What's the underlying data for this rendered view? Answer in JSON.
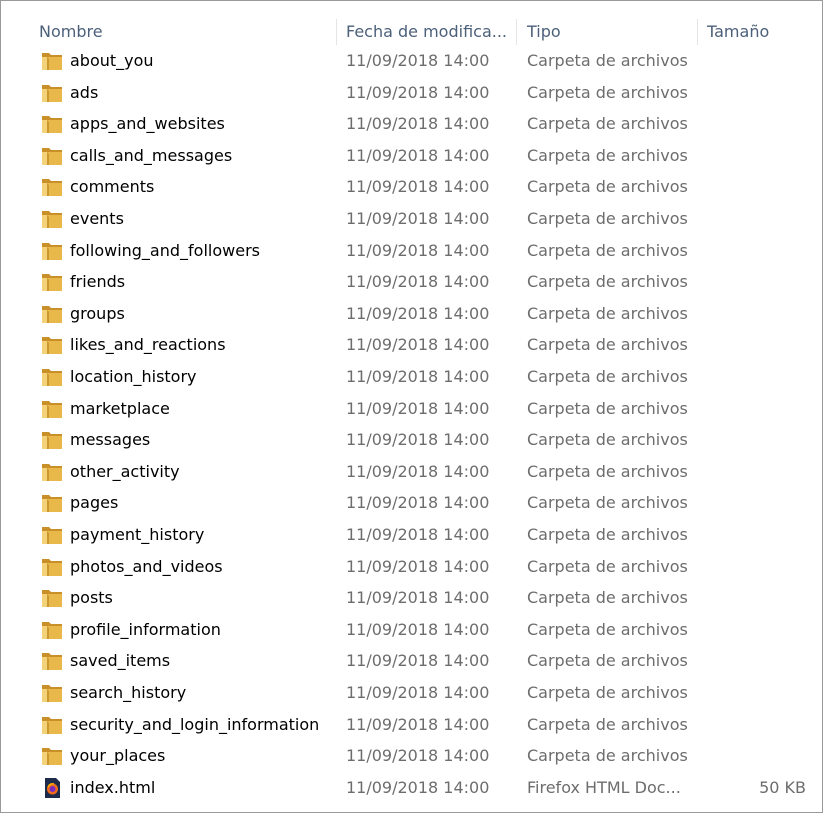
{
  "columns": {
    "name": "Nombre",
    "date": "Fecha de modifica...",
    "type": "Tipo",
    "size": "Tamaño"
  },
  "files": [
    {
      "name": "about_you",
      "date": "11/09/2018 14:00",
      "type": "Carpeta de archivos",
      "size": "",
      "icon": "folder-icon"
    },
    {
      "name": "ads",
      "date": "11/09/2018 14:00",
      "type": "Carpeta de archivos",
      "size": "",
      "icon": "folder-icon"
    },
    {
      "name": "apps_and_websites",
      "date": "11/09/2018 14:00",
      "type": "Carpeta de archivos",
      "size": "",
      "icon": "folder-icon"
    },
    {
      "name": "calls_and_messages",
      "date": "11/09/2018 14:00",
      "type": "Carpeta de archivos",
      "size": "",
      "icon": "folder-icon"
    },
    {
      "name": "comments",
      "date": "11/09/2018 14:00",
      "type": "Carpeta de archivos",
      "size": "",
      "icon": "folder-icon"
    },
    {
      "name": "events",
      "date": "11/09/2018 14:00",
      "type": "Carpeta de archivos",
      "size": "",
      "icon": "folder-icon"
    },
    {
      "name": "following_and_followers",
      "date": "11/09/2018 14:00",
      "type": "Carpeta de archivos",
      "size": "",
      "icon": "folder-icon"
    },
    {
      "name": "friends",
      "date": "11/09/2018 14:00",
      "type": "Carpeta de archivos",
      "size": "",
      "icon": "folder-icon"
    },
    {
      "name": "groups",
      "date": "11/09/2018 14:00",
      "type": "Carpeta de archivos",
      "size": "",
      "icon": "folder-icon"
    },
    {
      "name": "likes_and_reactions",
      "date": "11/09/2018 14:00",
      "type": "Carpeta de archivos",
      "size": "",
      "icon": "folder-icon"
    },
    {
      "name": "location_history",
      "date": "11/09/2018 14:00",
      "type": "Carpeta de archivos",
      "size": "",
      "icon": "folder-icon"
    },
    {
      "name": "marketplace",
      "date": "11/09/2018 14:00",
      "type": "Carpeta de archivos",
      "size": "",
      "icon": "folder-icon"
    },
    {
      "name": "messages",
      "date": "11/09/2018 14:00",
      "type": "Carpeta de archivos",
      "size": "",
      "icon": "folder-icon"
    },
    {
      "name": "other_activity",
      "date": "11/09/2018 14:00",
      "type": "Carpeta de archivos",
      "size": "",
      "icon": "folder-icon"
    },
    {
      "name": "pages",
      "date": "11/09/2018 14:00",
      "type": "Carpeta de archivos",
      "size": "",
      "icon": "folder-icon"
    },
    {
      "name": "payment_history",
      "date": "11/09/2018 14:00",
      "type": "Carpeta de archivos",
      "size": "",
      "icon": "folder-icon"
    },
    {
      "name": "photos_and_videos",
      "date": "11/09/2018 14:00",
      "type": "Carpeta de archivos",
      "size": "",
      "icon": "folder-icon"
    },
    {
      "name": "posts",
      "date": "11/09/2018 14:00",
      "type": "Carpeta de archivos",
      "size": "",
      "icon": "folder-icon"
    },
    {
      "name": "profile_information",
      "date": "11/09/2018 14:00",
      "type": "Carpeta de archivos",
      "size": "",
      "icon": "folder-icon"
    },
    {
      "name": "saved_items",
      "date": "11/09/2018 14:00",
      "type": "Carpeta de archivos",
      "size": "",
      "icon": "folder-icon"
    },
    {
      "name": "search_history",
      "date": "11/09/2018 14:00",
      "type": "Carpeta de archivos",
      "size": "",
      "icon": "folder-icon"
    },
    {
      "name": "security_and_login_information",
      "date": "11/09/2018 14:00",
      "type": "Carpeta de archivos",
      "size": "",
      "icon": "folder-icon"
    },
    {
      "name": "your_places",
      "date": "11/09/2018 14:00",
      "type": "Carpeta de archivos",
      "size": "",
      "icon": "folder-icon"
    },
    {
      "name": "index.html",
      "date": "11/09/2018 14:00",
      "type": "Firefox HTML Doc...",
      "size": "50 KB",
      "icon": "firefox-html-file-icon"
    }
  ],
  "colors": {
    "header_text": "#4c607a",
    "secondary_text": "#6d6d6d",
    "folder_body": "#e8b84a",
    "folder_dark": "#c9902a"
  }
}
